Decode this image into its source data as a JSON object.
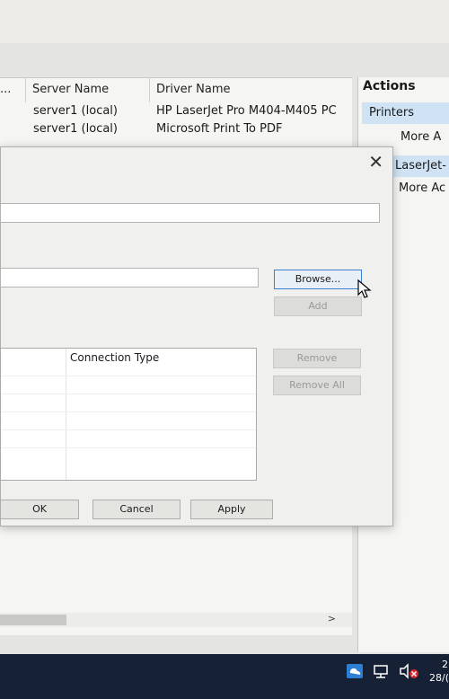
{
  "table": {
    "headers": [
      "...",
      "Server Name",
      "Driver Name"
    ],
    "rows": [
      {
        "server": "server1 (local)",
        "driver": "HP LaserJet Pro M404-M405 PC"
      },
      {
        "server": "server1 (local)",
        "driver": "Microsoft Print To PDF"
      }
    ]
  },
  "actions": {
    "title": "Actions",
    "section1": "Printers",
    "link1": "More A",
    "section2": "LaserJet-",
    "link2": "More Ac"
  },
  "dialog": {
    "close_glyph": "✕",
    "browse": "Browse...",
    "add": "Add",
    "remove": "Remove",
    "remove_all": "Remove All",
    "connection_type": "Connection Type",
    "ok": "OK",
    "cancel": "Cancel",
    "apply": "Apply"
  },
  "scroll": {
    "right_arrow": ">"
  },
  "taskbar": {
    "clock_partial": "2",
    "date_partial": "28/("
  },
  "icons": [
    "close-icon",
    "cursor-icon",
    "network-icon",
    "volume-muted-icon",
    "onedrive-icon"
  ],
  "colors": {
    "accent": "#3c7fd0",
    "selection": "#cfe3f5",
    "taskbar": "#172135"
  }
}
